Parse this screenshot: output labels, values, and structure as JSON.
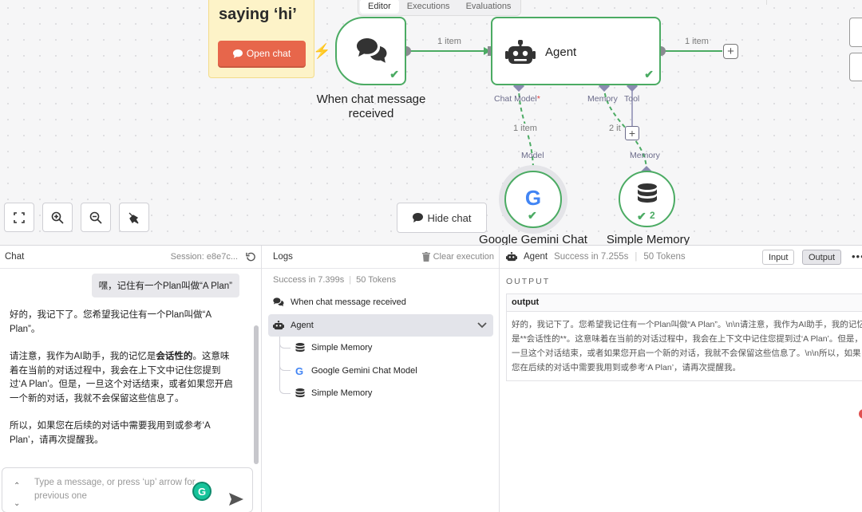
{
  "canvas": {
    "tabs": [
      {
        "label": "Editor",
        "active": true
      },
      {
        "label": "Executions",
        "active": false
      },
      {
        "label": "Evaluations",
        "active": false
      }
    ],
    "sticky": {
      "title": "saying ‘hi’",
      "button": "Open chat"
    },
    "nodes": {
      "trigger": {
        "label_line1": "When chat message",
        "label_line2": "received"
      },
      "agent": {
        "label": "Agent"
      },
      "gemini": {
        "label": "Google Gemini Chat"
      },
      "memory": {
        "label": "Simple Memory",
        "badge": "2"
      }
    },
    "edges": {
      "trigger_agent": "1 item",
      "agent_out": "1 item",
      "model_link": "1 item",
      "memory_link": "2 it"
    },
    "ports": {
      "chat_model": "Chat Model",
      "memory": "Memory",
      "tool": "Tool",
      "model": "Model",
      "memory_in": "Memory"
    },
    "hide_chat": "Hide chat"
  },
  "chat": {
    "title": "Chat",
    "session": "Session: e8e7c...",
    "user_message": "嘿，记住有一个Plan叫做“A Plan”",
    "bot_p1": "好的，我记下了。您希望我记住有一个Plan叫做“A Plan”。",
    "bot_p2a": "请注意，我作为AI助手，我的记忆是",
    "bot_p2b": "会话性的",
    "bot_p2c": "。这意味着在当前的对话过程中，我会在上下文中记住您提到过‘A Plan’。但是，一旦这个对话结束，或者如果您开启一个新的对话，我就不会保留这些信息了。",
    "bot_p3": "所以，如果您在后续的对话中需要我用到或参考‘A Plan’，请再次提醒我。",
    "input_placeholder": "Type a message, or press ‘up’ arrow for previous one"
  },
  "logs": {
    "title": "Logs",
    "clear": "Clear execution",
    "status": "Success in 7.399s",
    "tokens": "50 Tokens",
    "rows": [
      {
        "label": "When chat message received"
      },
      {
        "label": "Agent"
      },
      {
        "label": "Simple Memory"
      },
      {
        "label": "Google Gemini Chat Model"
      },
      {
        "label": "Simple Memory"
      }
    ]
  },
  "output": {
    "node": "Agent",
    "status": "Success in 7.255s",
    "tokens": "50 Tokens",
    "input_btn": "Input",
    "output_btn": "Output",
    "section_label": "OUTPUT",
    "column": "output",
    "value": "好的，我记下了。您希望我记住有一个Plan叫做“A Plan”。\\n\\n请注意，我作为AI助手，我的记忆是**会话性的**。这意味着在当前的对话过程中，我会在上下文中记住您提到过‘A Plan’。但是，一旦这个对话结束，或者如果您开启一个新的对话，我就不会保留这些信息了。\\n\\n所以，如果您在后续的对话中需要我用到或参考‘A Plan’，请再次提醒我。"
  },
  "colors": {
    "success": "#4bab63",
    "accent": "#ff6d5a",
    "port": "#8a8ab0"
  }
}
